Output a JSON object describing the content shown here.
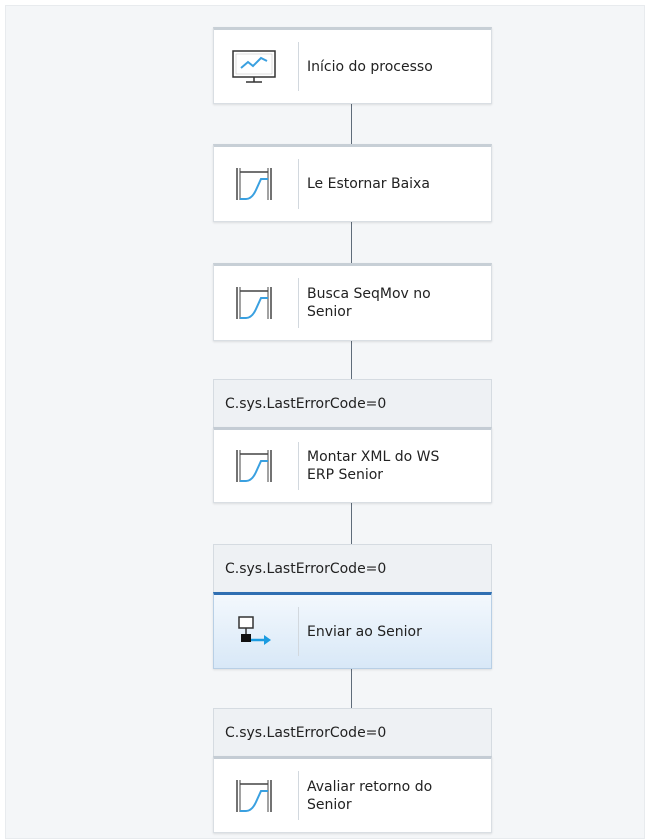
{
  "flow": {
    "nodes": [
      {
        "label": "Início do processo",
        "icon": "monitor-chart-icon"
      },
      {
        "label": "Le Estornar Baixa",
        "icon": "gate-ramp-icon"
      },
      {
        "label": "Busca SeqMov no\nSenior",
        "icon": "gate-ramp-icon"
      },
      {
        "condition": "C.sys.LastErrorCode=0",
        "label": "Montar XML do WS\nERP Senior",
        "icon": "gate-ramp-icon"
      },
      {
        "condition": "C.sys.LastErrorCode=0",
        "label": "Enviar ao Senior",
        "icon": "network-send-icon",
        "selected": true
      },
      {
        "condition": "C.sys.LastErrorCode=0",
        "label": "Avaliar retorno do\nSenior",
        "icon": "gate-ramp-icon"
      }
    ]
  },
  "colors": {
    "accent": "#2f6fb2",
    "ramp": "#3aa0e0",
    "send_arrow": "#1b9be0"
  }
}
